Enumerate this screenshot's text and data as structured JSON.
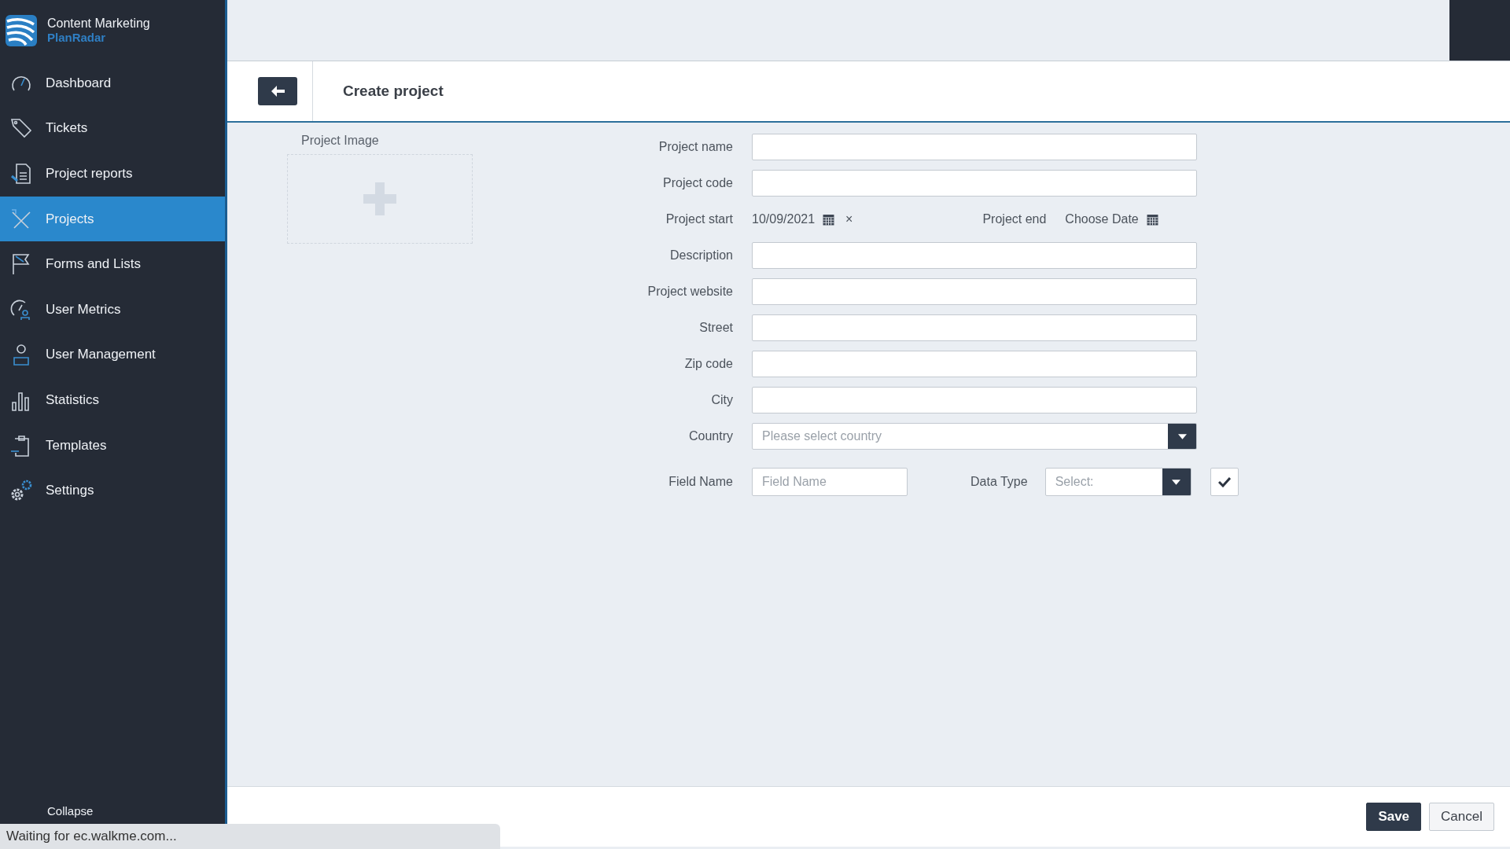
{
  "app": {
    "workspace": "Content Marketing",
    "brand": "PlanRadar"
  },
  "sidebar": {
    "items": [
      {
        "label": "Dashboard",
        "selected": false
      },
      {
        "label": "Tickets",
        "selected": false
      },
      {
        "label": "Project reports",
        "selected": false
      },
      {
        "label": "Projects",
        "selected": true
      },
      {
        "label": "Forms and Lists",
        "selected": false
      },
      {
        "label": "User Metrics",
        "selected": false
      },
      {
        "label": "User Management",
        "selected": false
      },
      {
        "label": "Statistics",
        "selected": false
      },
      {
        "label": "Templates",
        "selected": false
      },
      {
        "label": "Settings",
        "selected": false
      }
    ],
    "collapse": "Collapse"
  },
  "header": {
    "title": "Create project"
  },
  "image": {
    "label": "Project Image"
  },
  "form": {
    "fields": [
      {
        "kind": "text",
        "label": "Project name"
      },
      {
        "kind": "text",
        "label": "Project code"
      },
      {
        "kind": "dates",
        "label": "Project start",
        "value": "10/09/2021",
        "clear": "×",
        "end_label": "Project end",
        "end_value": "Choose Date"
      },
      {
        "kind": "text",
        "label": "Description"
      },
      {
        "kind": "text",
        "label": "Project website"
      },
      {
        "kind": "text",
        "label": "Street"
      },
      {
        "kind": "text",
        "label": "Zip code"
      },
      {
        "kind": "text",
        "label": "City"
      },
      {
        "kind": "select",
        "label": "Country",
        "placeholder": "Please select country"
      }
    ],
    "custom_field": {
      "label": "Field Name",
      "placeholder": "Field Name",
      "type_label": "Data Type",
      "type_placeholder": "Select:"
    }
  },
  "footer": {
    "buttons": [
      {
        "label": "Save",
        "kind": "primary"
      },
      {
        "label": "Cancel",
        "kind": "secondary"
      }
    ]
  },
  "status_bar": "Waiting for ec.walkme.com..."
}
